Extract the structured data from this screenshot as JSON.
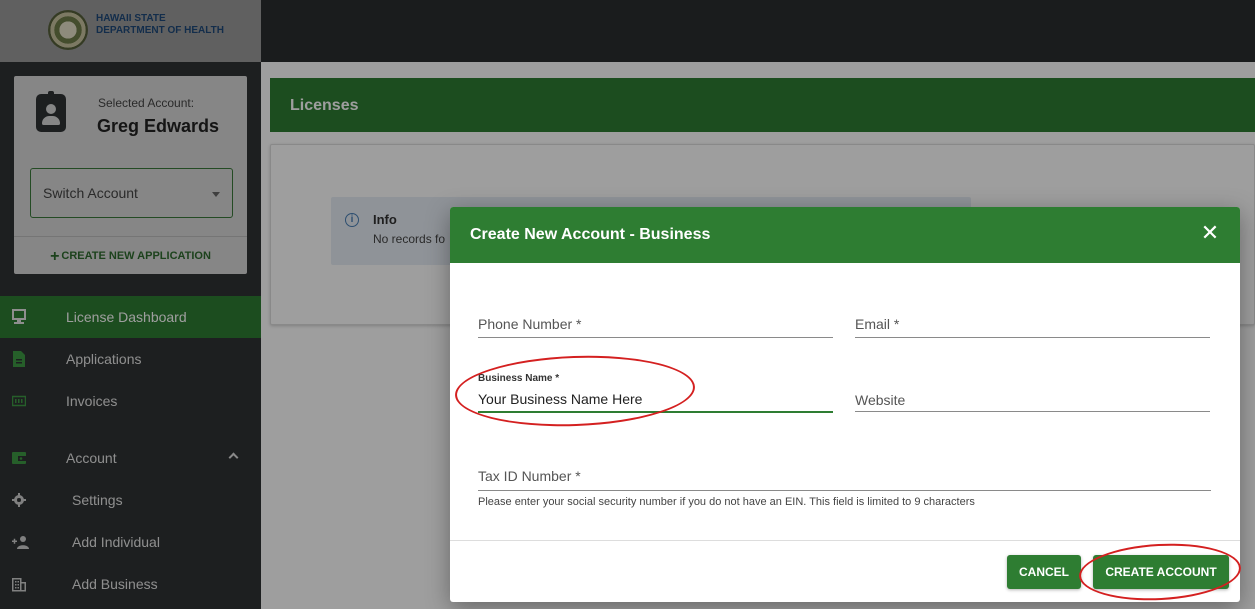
{
  "header": {
    "department_line1": "HAWAII STATE",
    "department_line2": "DEPARTMENT OF HEALTH"
  },
  "sidebar": {
    "selected_account_label": "Selected Account:",
    "selected_account_name": "Greg Edwards",
    "switch_account_label": "Switch Account",
    "create_application_label": "CREATE NEW APPLICATION",
    "items": [
      {
        "label": "License Dashboard",
        "icon": "dashboard-icon"
      },
      {
        "label": "Applications",
        "icon": "document-icon"
      },
      {
        "label": "Invoices",
        "icon": "invoice-icon"
      },
      {
        "label": "Account",
        "icon": "wallet-icon"
      },
      {
        "label": "Settings",
        "icon": "gear-icon"
      },
      {
        "label": "Add Individual",
        "icon": "add-person-icon"
      },
      {
        "label": "Add Business",
        "icon": "building-icon"
      }
    ]
  },
  "main": {
    "title": "Licenses",
    "info_title": "Info",
    "info_text": "No records fo"
  },
  "modal": {
    "title": "Create New Account - Business",
    "close_label": "✕",
    "fields": {
      "phone_label": "Phone Number *",
      "email_label": "Email *",
      "business_name_label": "Business Name *",
      "business_name_value": "Your Business Name Here",
      "website_label": "Website",
      "tax_id_label": "Tax ID Number *",
      "tax_id_hint": "Please enter your social security number if you do not have an EIN. This field is limited to 9 characters"
    },
    "cancel_label": "CANCEL",
    "create_label": "CREATE ACCOUNT"
  },
  "colors": {
    "brand_green": "#2e7d32",
    "sidebar_bg": "#2f3334",
    "annotation_red": "#d42020"
  }
}
